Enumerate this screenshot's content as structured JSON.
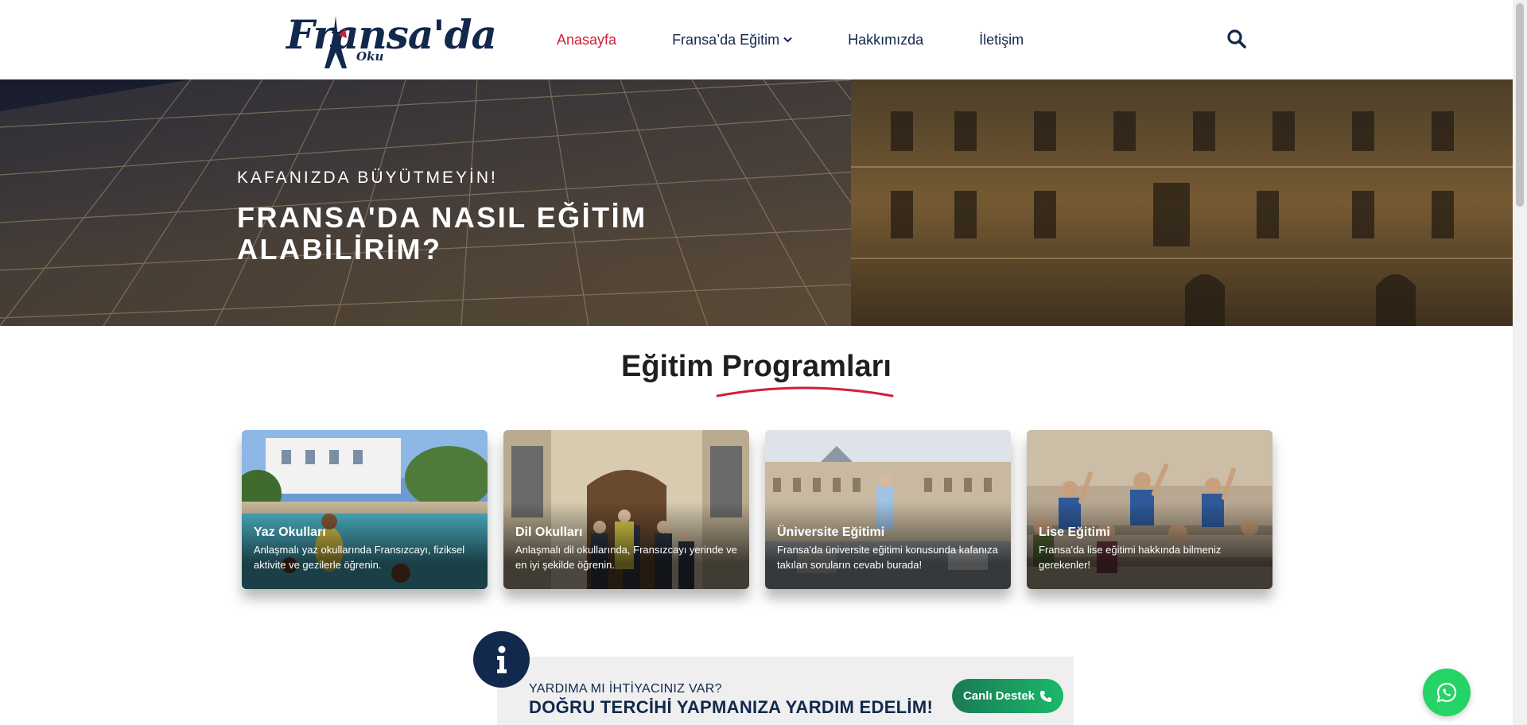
{
  "header": {
    "logo_text": "Fransa'da",
    "logo_sub": "Oku",
    "nav": [
      {
        "label": "Anasayfa",
        "active": true
      },
      {
        "label": "Fransa’da Eğitim",
        "has_dropdown": true
      },
      {
        "label": "Hakkımızda"
      },
      {
        "label": "İletişim"
      }
    ],
    "search_icon": "search-icon"
  },
  "hero": {
    "kicker": "KAFANIZDA BÜYÜTMEYİN!",
    "title": "FRANSA'DA NASIL EĞİTİM ALABİLİRİM?"
  },
  "section": {
    "title": "Eğitim Programları",
    "accent_color": "#d11f3a"
  },
  "cards": [
    {
      "title": "Yaz Okulları",
      "desc": "Anlaşmalı yaz okullarında Fransızcayı, fiziksel aktivite ve gezilerle öğrenin."
    },
    {
      "title": "Dil Okulları",
      "desc": "Anlaşmalı dil okullarında, Fransızcayı yerinde ve en iyi şekilde öğrenin."
    },
    {
      "title": "Üniversite Eğitimi",
      "desc": "Fransa'da üniversite eğitimi konusunda kafanıza takılan soruların cevabı burada!"
    },
    {
      "title": "Lise Eğitimi",
      "desc": "Fransa'da lise eğitimi hakkında bilmeniz gerekenler!"
    }
  ],
  "help": {
    "small": "YARDIMA MI İHTİYACINIZ VAR?",
    "big": "DOĞRU TERCİHİ YAPMANIZA YARDIM EDELİM!",
    "button": "Canlı Destek",
    "info_icon": "info-icon",
    "phone_icon": "phone-icon"
  },
  "whatsapp": {
    "icon": "whatsapp-icon"
  },
  "colors": {
    "navy": "#12284c",
    "red": "#d11f3a",
    "green": "#25d366"
  }
}
